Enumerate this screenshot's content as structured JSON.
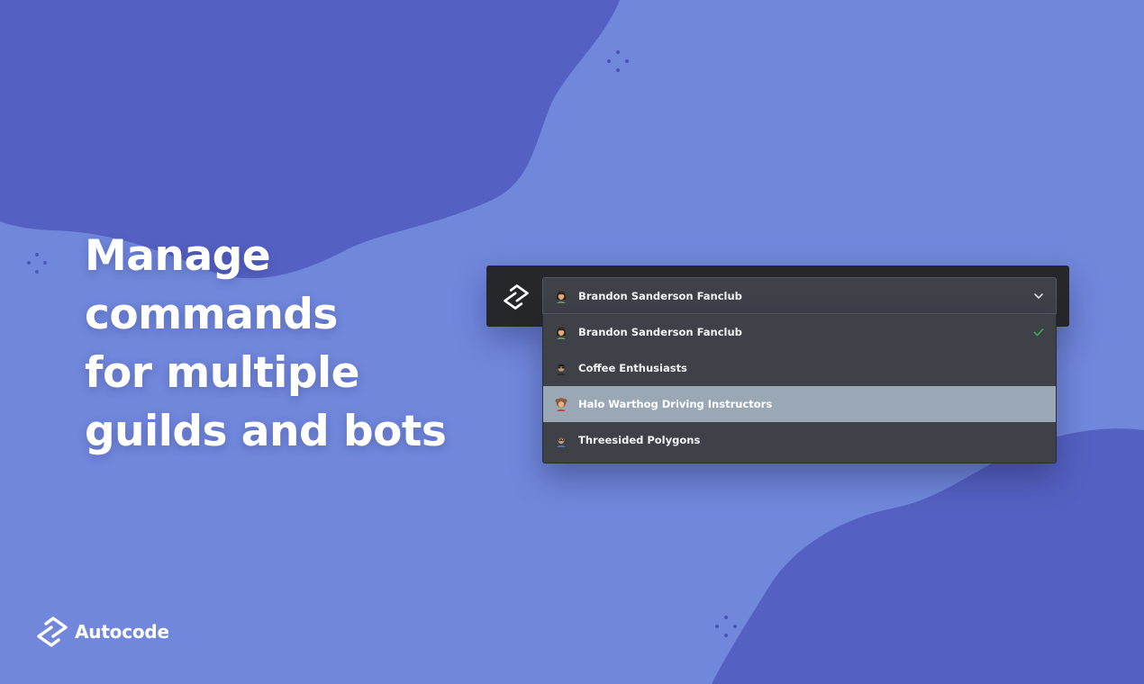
{
  "headline": {
    "lines": [
      "Manage",
      "commands",
      "for multiple",
      "guilds and bots"
    ]
  },
  "brand": {
    "name": "Autocode",
    "icon": "autocode-logo-icon"
  },
  "guild_selector": {
    "selected_label": "Brandon Sanderson Fanclub",
    "expanded": true,
    "options": [
      {
        "label": "Brandon Sanderson Fanclub",
        "selected": true,
        "highlighted": false,
        "avatar": "guild-avatar-icon"
      },
      {
        "label": "Coffee Enthusiasts",
        "selected": false,
        "highlighted": false,
        "avatar": "guild-avatar-icon"
      },
      {
        "label": "Halo Warthog Driving Instructors",
        "selected": false,
        "highlighted": true,
        "avatar": "guild-avatar-icon"
      },
      {
        "label": "Threesided Polygons",
        "selected": false,
        "highlighted": false,
        "avatar": "guild-avatar-icon"
      }
    ]
  },
  "colors": {
    "background": "#7087dc",
    "blob": "#5461c2",
    "topbar": "#26272b",
    "dropdown": "#3e4148",
    "highlight": "#9aa8b6",
    "check": "#3ba55c"
  }
}
